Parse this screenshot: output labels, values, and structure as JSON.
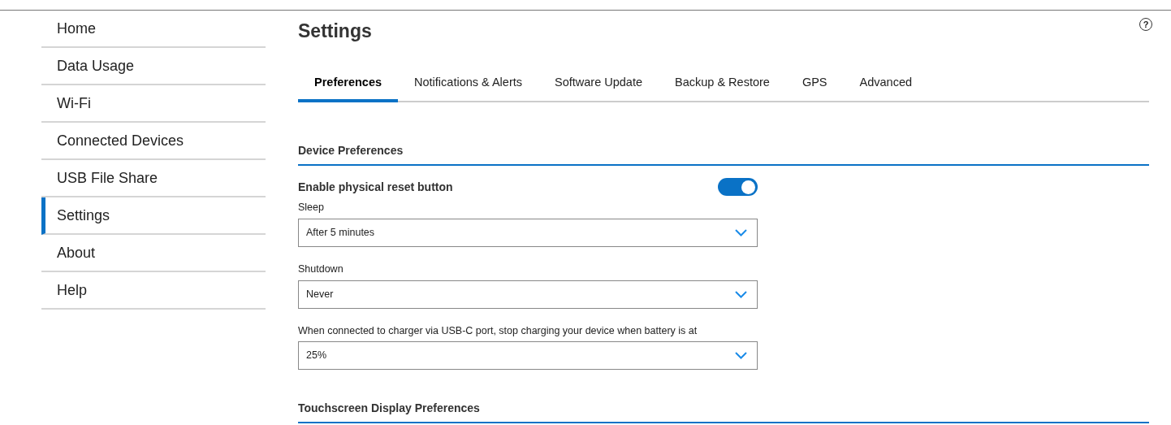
{
  "sidebar": {
    "items": [
      {
        "label": "Home",
        "selected": false
      },
      {
        "label": "Data Usage",
        "selected": false
      },
      {
        "label": "Wi-Fi",
        "selected": false
      },
      {
        "label": "Connected Devices",
        "selected": false
      },
      {
        "label": "USB File Share",
        "selected": false
      },
      {
        "label": "Settings",
        "selected": true
      },
      {
        "label": "About",
        "selected": false
      },
      {
        "label": "Help",
        "selected": false
      }
    ]
  },
  "page": {
    "title": "Settings",
    "help": "?"
  },
  "tabs": [
    {
      "label": "Preferences",
      "selected": true
    },
    {
      "label": "Notifications & Alerts",
      "selected": false
    },
    {
      "label": "Software Update",
      "selected": false
    },
    {
      "label": "Backup & Restore",
      "selected": false
    },
    {
      "label": "GPS",
      "selected": false
    },
    {
      "label": "Advanced",
      "selected": false
    }
  ],
  "sections": [
    {
      "title": "Device Preferences",
      "items": [
        {
          "kind": "toggle",
          "label": "Enable physical reset button",
          "on": true
        },
        {
          "kind": "select",
          "label": "Sleep",
          "value": "After 5 minutes"
        },
        {
          "kind": "select",
          "label": "Shutdown",
          "value": "Never"
        },
        {
          "kind": "select",
          "label": "When connected to charger via USB-C port, stop charging your device when battery is at",
          "value": "25%"
        }
      ]
    },
    {
      "title": "Touchscreen Display Preferences"
    }
  ]
}
